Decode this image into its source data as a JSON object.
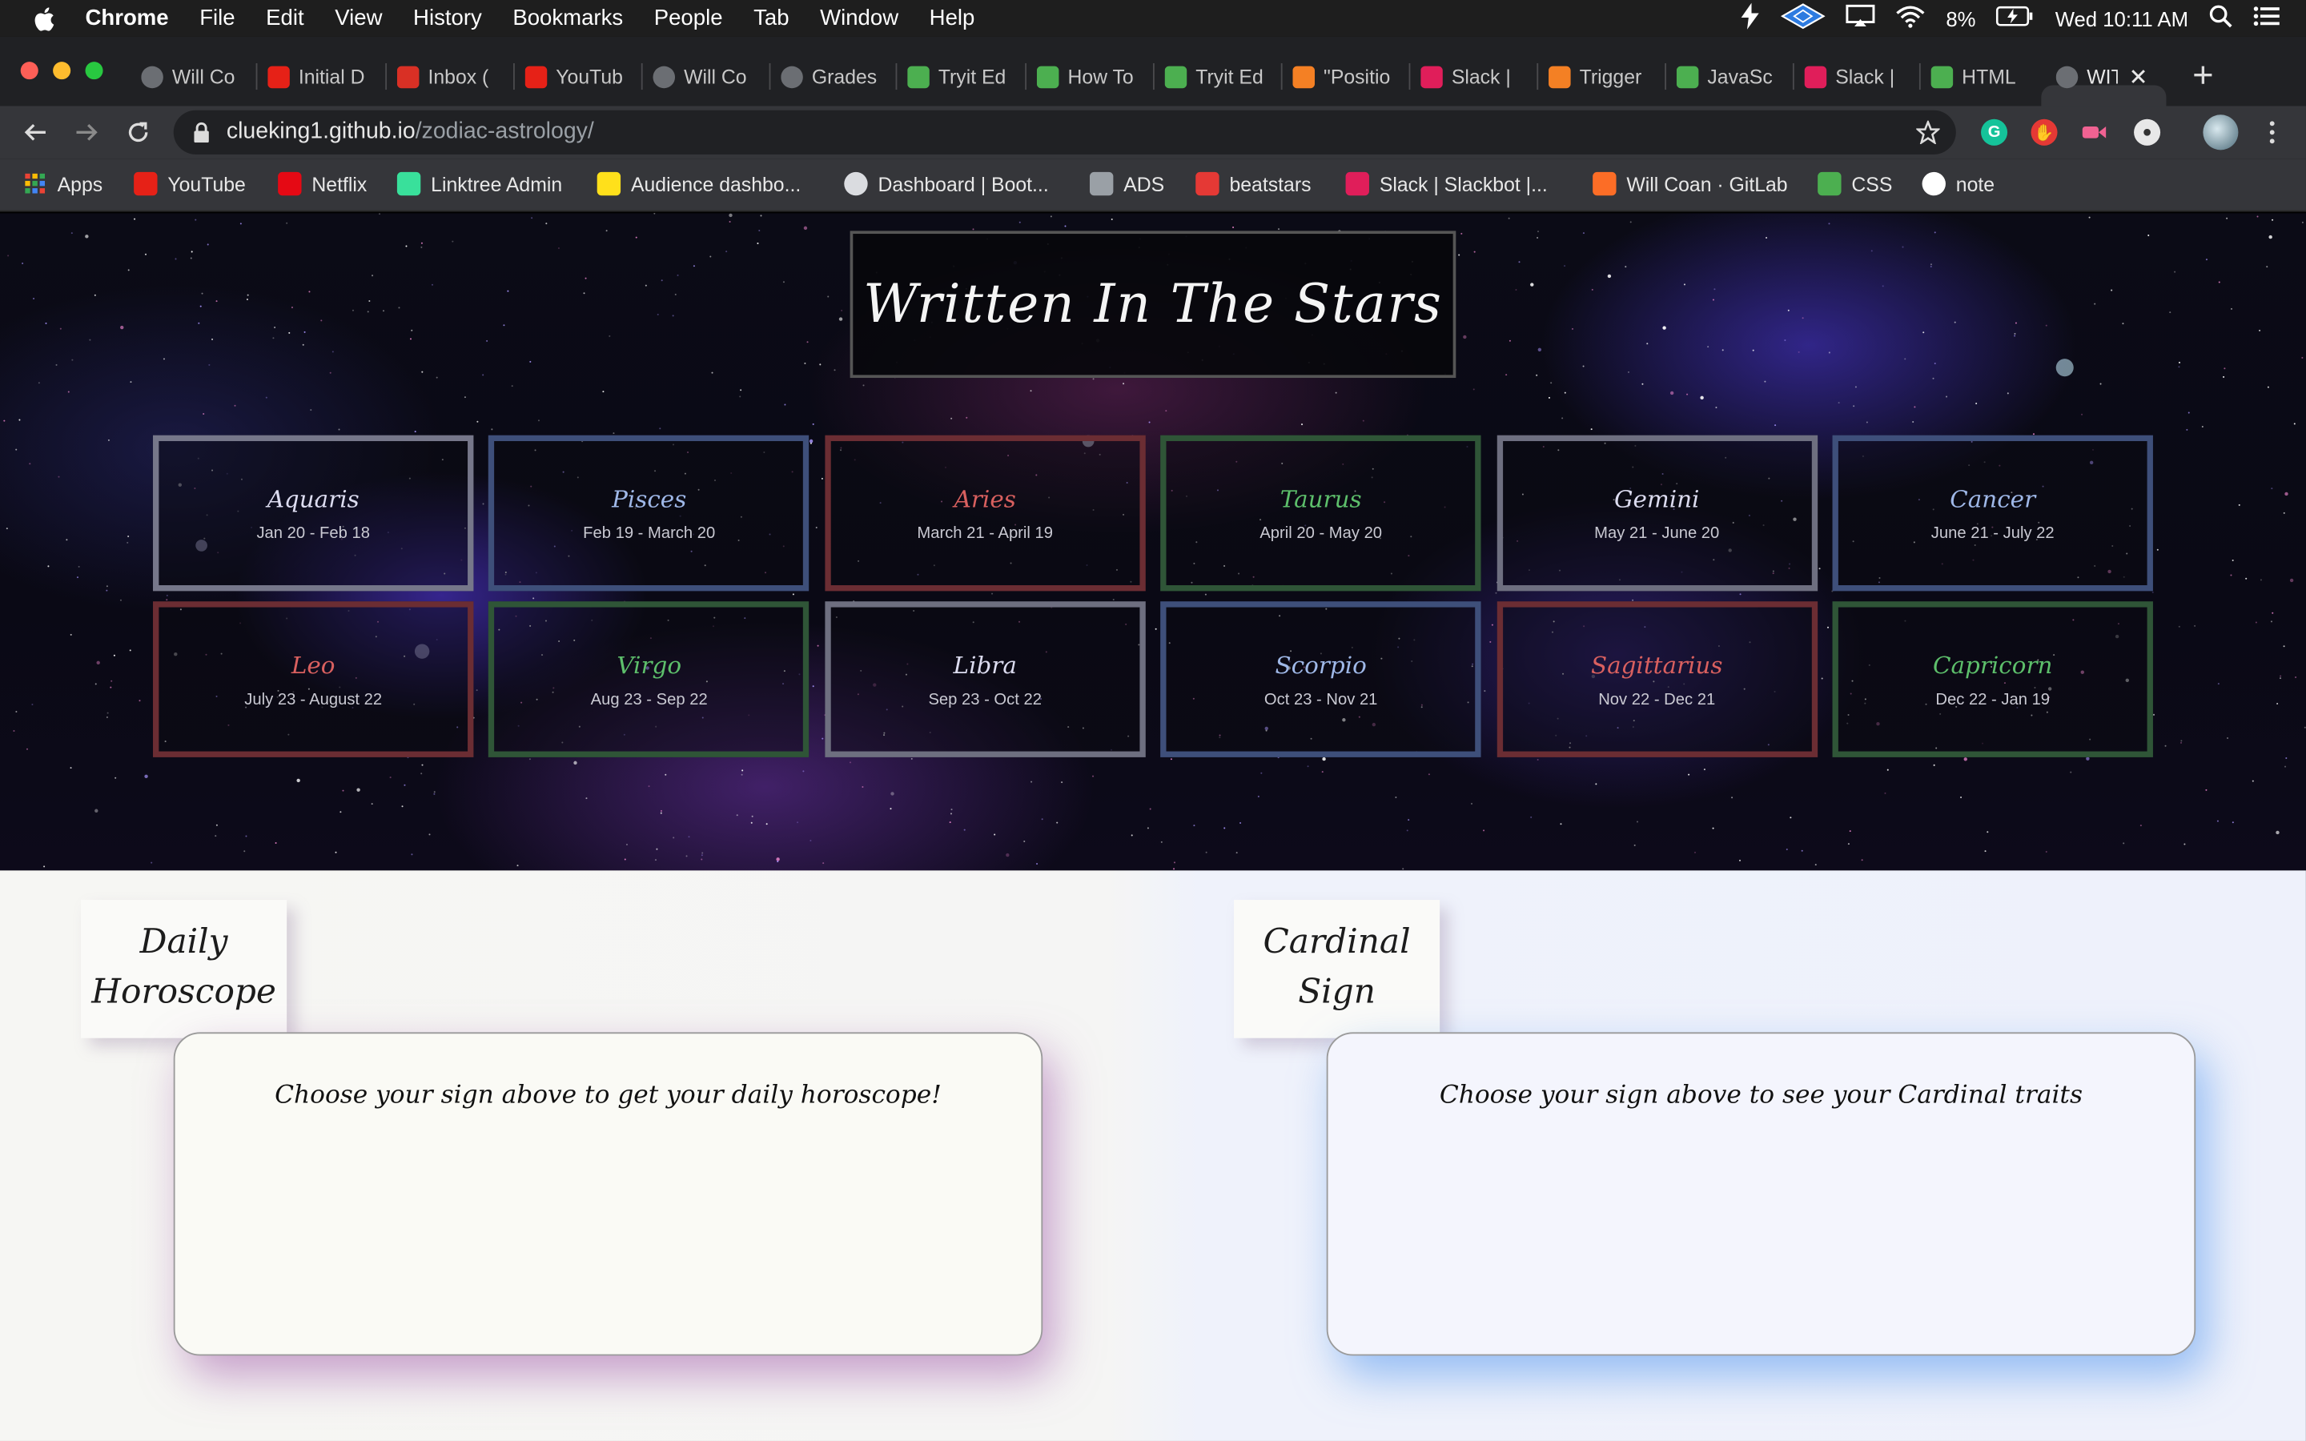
{
  "menubar": {
    "app": "Chrome",
    "items": [
      "File",
      "Edit",
      "View",
      "History",
      "Bookmarks",
      "People",
      "Tab",
      "Window",
      "Help"
    ],
    "battery": "8%",
    "clock": "Wed 10:11 AM"
  },
  "tabs": [
    {
      "label": "Will Co",
      "icon": "globe-icon",
      "color": "#5f6368"
    },
    {
      "label": "Initial D",
      "icon": "youtube-icon",
      "color": "#e62117"
    },
    {
      "label": "Inbox (",
      "icon": "gmail-icon",
      "color": "#d93025"
    },
    {
      "label": "YouTub",
      "icon": "youtube-icon",
      "color": "#e62117"
    },
    {
      "label": "Will Co",
      "icon": "globe-icon",
      "color": "#5f6368"
    },
    {
      "label": "Grades",
      "icon": "globe-icon",
      "color": "#5f6368"
    },
    {
      "label": "Tryit Ed",
      "icon": "w3schools-icon",
      "color": "#4caf50"
    },
    {
      "label": "How To",
      "icon": "w3schools-icon",
      "color": "#4caf50"
    },
    {
      "label": "Tryit Ed",
      "icon": "w3schools-icon",
      "color": "#4caf50"
    },
    {
      "label": "\"Positio",
      "icon": "stackoverflow-icon",
      "color": "#f48024"
    },
    {
      "label": "Slack |",
      "icon": "slack-icon",
      "color": "#e01e5a"
    },
    {
      "label": "Trigger",
      "icon": "stackoverflow-icon",
      "color": "#f48024"
    },
    {
      "label": "JavaSc",
      "icon": "w3schools-icon",
      "color": "#4caf50"
    },
    {
      "label": "Slack |",
      "icon": "slack-icon",
      "color": "#e01e5a"
    },
    {
      "label": "HTML",
      "icon": "w3schools-icon",
      "color": "#4caf50"
    },
    {
      "label": "WIT",
      "icon": "globe-icon",
      "color": "#5f6368"
    }
  ],
  "address": {
    "host": "clueking1.github.io",
    "path": "/zodiac-astrology/"
  },
  "bookmarks": [
    {
      "label": "Apps",
      "icon": "apps-grid-icon",
      "color": "#4285f4"
    },
    {
      "label": "YouTube",
      "icon": "youtube-icon",
      "color": "#e62117"
    },
    {
      "label": "Netflix",
      "icon": "netflix-icon",
      "color": "#e50914"
    },
    {
      "label": "Linktree Admin",
      "icon": "linktree-icon",
      "color": "#39e09b"
    },
    {
      "label": "Audience dashbo...",
      "icon": "mailchimp-icon",
      "color": "#ffe01b"
    },
    {
      "label": "Dashboard | Boot...",
      "icon": "globe-icon",
      "color": "#dadce0"
    },
    {
      "label": "ADS",
      "icon": "ads-icon",
      "color": "#9aa0a6"
    },
    {
      "label": "beatstars",
      "icon": "beatstars-icon",
      "color": "#e53935"
    },
    {
      "label": "Slack | Slackbot |...",
      "icon": "slack-icon",
      "color": "#e01e5a"
    },
    {
      "label": "Will Coan · GitLab",
      "icon": "gitlab-icon",
      "color": "#fc6d26"
    },
    {
      "label": "CSS",
      "icon": "w3schools-icon",
      "color": "#4caf50"
    },
    {
      "label": "note",
      "icon": "google-icon",
      "color": "#ffffff"
    }
  ],
  "site": {
    "title": "Written In The Stars",
    "signs": [
      {
        "name": "Aquaris",
        "dates": "Jan 20 - Feb 18",
        "color": "#dcdcf0",
        "border": "#76778a"
      },
      {
        "name": "Pisces",
        "dates": "Feb 19 - March 20",
        "color": "#9fb8e8",
        "border": "#3e4f7a"
      },
      {
        "name": "Aries",
        "dates": "March 21 - April 19",
        "color": "#d9605f",
        "border": "#6b2d33"
      },
      {
        "name": "Taurus",
        "dates": "April 20 - May 20",
        "color": "#5dbf6b",
        "border": "#2f5537"
      },
      {
        "name": "Gemini",
        "dates": "May 21 - June 20",
        "color": "#dcdcf0",
        "border": "#6e6f80"
      },
      {
        "name": "Cancer",
        "dates": "June 21 - July 22",
        "color": "#9fb8e8",
        "border": "#3e4f7a"
      },
      {
        "name": "Leo",
        "dates": "July 23 - August 22",
        "color": "#d9605f",
        "border": "#6b2d33"
      },
      {
        "name": "Virgo",
        "dates": "Aug 23 - Sep 22",
        "color": "#5dbf6b",
        "border": "#2f5537"
      },
      {
        "name": "Libra",
        "dates": "Sep 23 - Oct 22",
        "color": "#dcdcf0",
        "border": "#6e6f80"
      },
      {
        "name": "Scorpio",
        "dates": "Oct 23 - Nov 21",
        "color": "#9fb8e8",
        "border": "#3e4f7a"
      },
      {
        "name": "Sagittarius",
        "dates": "Nov 22 - Dec 21",
        "color": "#d9605f",
        "border": "#6b2d33"
      },
      {
        "name": "Capricorn",
        "dates": "Dec 22 - Jan 19",
        "color": "#5dbf6b",
        "border": "#2f5537"
      }
    ],
    "daily": {
      "title": "Daily Horoscope",
      "prompt": "Choose your sign above to get your daily horoscope!"
    },
    "cardinal": {
      "title": "Cardinal Sign",
      "prompt": "Choose your sign above to see your Cardinal traits"
    }
  }
}
